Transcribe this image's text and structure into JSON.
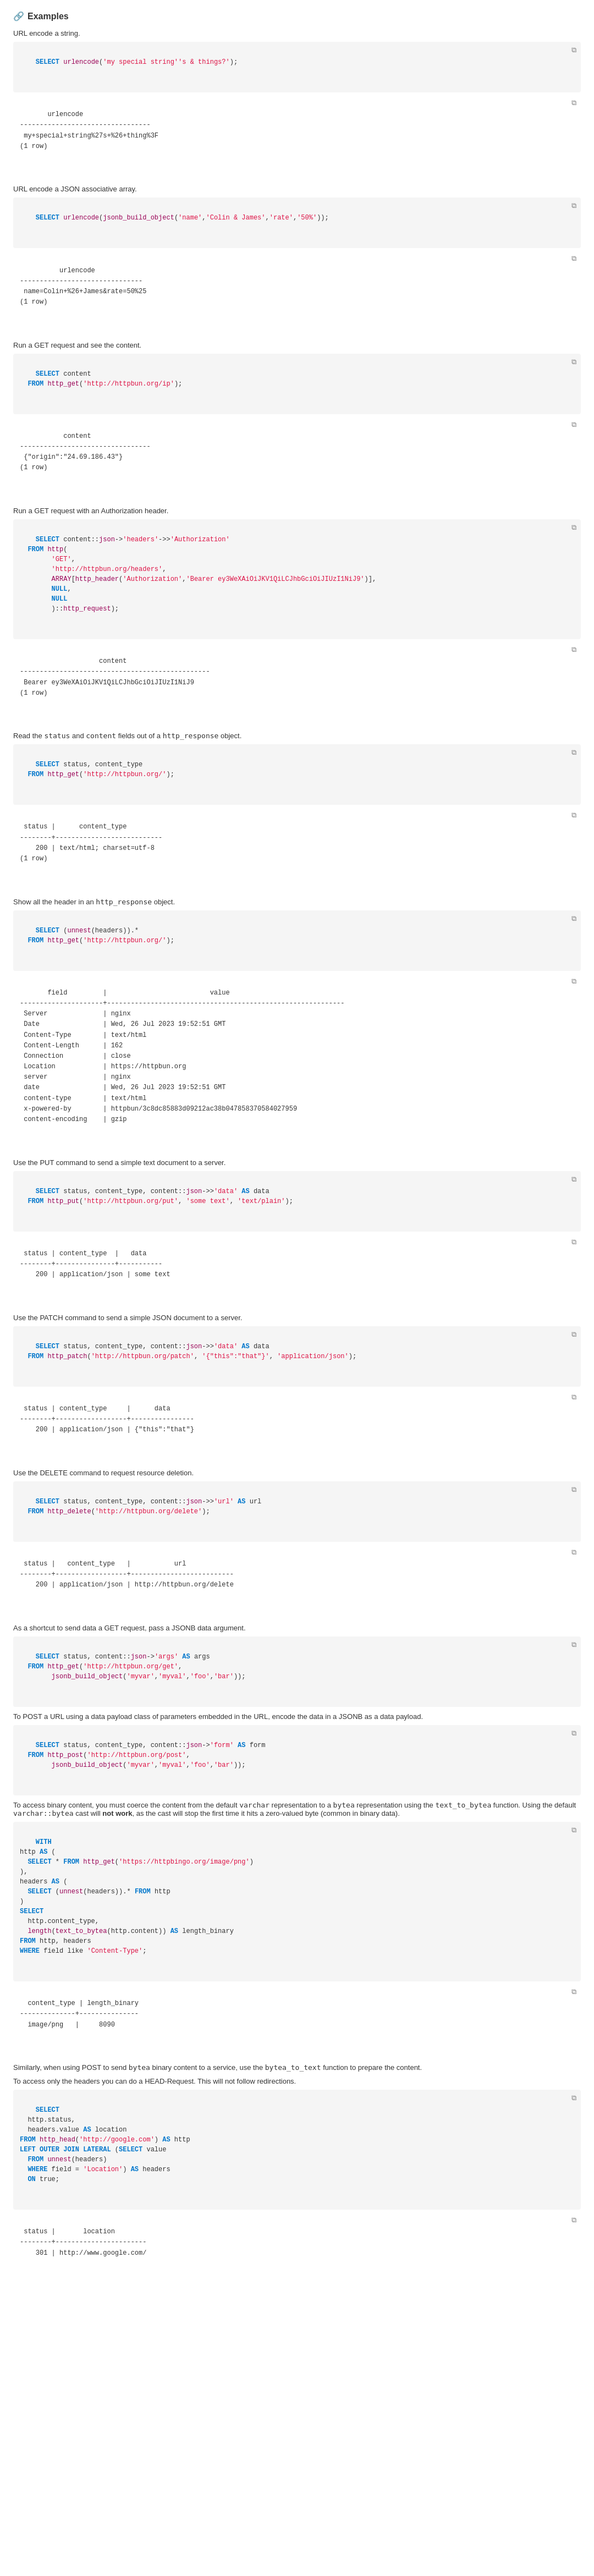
{
  "page": {
    "title": "Examples",
    "sections": [
      {
        "id": "url-encode-string",
        "desc": "URL encode a string.",
        "query": "SELECT urlencode('my special string''s & things?');",
        "result": "       urlencode\n---------------------------------\n my+special+string%27s+%26+thing%3F\n(1 row)"
      },
      {
        "id": "url-encode-json",
        "desc": "URL encode a JSON associative array.",
        "query": "SELECT urlencode(jsonb_build_object('name','Colin & James','rate','50%'));",
        "result": "          urlencode\n-------------------------------\n name=Colin+%26+James&rate=50%25\n(1 row)"
      },
      {
        "id": "get-content",
        "desc": "Run a GET request and see the content.",
        "query": "SELECT content\n  FROM http_get('http://httpbun.org/ip');",
        "result": "           content\n---------------------------------\n {\"origin\":\"24.69.186.43\"}\n(1 row)"
      },
      {
        "id": "get-auth",
        "desc": "Run a GET request with an Authorization header.",
        "query": "SELECT content::json->'headers'->>'Authorization'\n  FROM http(\n        'GET',\n        'http://httpbun.org/headers',\n        ARRAY[http_header('Authorization','Bearer ey3WeXAiOiJKV1QiLCJhbGciOiJIUzI1NiJ9')],\n        NULL,\n        NULL\n        )::http_request);",
        "result": "                    content\n------------------------------------------------\n Bearer ey3WeXAiOiJKV1QiLCJhbGciOiJIUzI1NiJ9\n(1 row)"
      },
      {
        "id": "read-status-content",
        "desc": "Read the status and content fields out of a http_response object.",
        "query": "SELECT status, content_type\n  FROM http_get('http://httpbun.org/');",
        "result": " status |      content_type\n--------+---------------------------\n    200 | text/html; charset=utf-8\n(1 row)"
      },
      {
        "id": "show-all-headers",
        "desc": "Show all the header in an http_response object.",
        "query": "SELECT (unnest(headers)).*\n  FROM http_get('http://httpbun.org/');",
        "result": "       field         |                          value\n---------------------+------------------------------------------------------------\n Server              | nginx\n Date                | Wed, 26 Jul 2023 19:52:51 GMT\n Content-Type        | text/html\n Content-Length      | 162\n Connection          | close\n Location            | https://httpbun.org\n server              | nginx\n date                | Wed, 26 Jul 2023 19:52:51 GMT\n content-type        | text/html\n x-powered-by        | httpbun/3c8dc85883d09212ac38b047858370584027959\n content-encoding    | gzip"
      },
      {
        "id": "put-simple-text",
        "desc": "Use the PUT command to send a simple text document to a server.",
        "query": "SELECT status, content_type, content::json->>'data' AS data\n  FROM http_put('http://httpbun.org/put', 'some text', 'text/plain');",
        "result": " status | content_type | data\n--------+--------------+-----------\n    200 | application/json | some text"
      },
      {
        "id": "patch-simple-json",
        "desc": "Use the PATCH command to send a simple JSON document to a server.",
        "query": "SELECT status, content_type, content::json->>'data' AS data\n  FROM http_patch('http://httpbun.org/patch', '{\"this\":\"that\"}', 'application/json');",
        "result": " status | content_type |      data\n--------+--------------+----------------\n    200 | application/json | {\"this\":\"that\"}"
      },
      {
        "id": "delete-resource",
        "desc": "Use the DELETE command to request resource deletion.",
        "query": "SELECT status, content_type, content::json->>'url' AS url\n  FROM http_delete('http://httpbun.org/delete');",
        "result": " status |   content_type   |           url\n--------+------------------+--------------------------\n    200 | application/json | http://httpbun.org/delete"
      },
      {
        "id": "get-jsonb-args",
        "desc": "As a shortcut to send data a GET request, pass a JSONB data argument.",
        "query": "SELECT status, content::json->'args' AS args\n  FROM http_get('http://httpbun.org/get',\n        jsonb_build_object('myvar','myval','foo','bar'));",
        "result": ""
      },
      {
        "id": "post-url-encoded",
        "desc": "To POST a URL using a data payload class of parameters embedded in the URL, encode the data in a JSONB as a data payload.",
        "query": "SELECT status, content_type, content::json->'form' AS form\n  FROM http_post('http://httpbun.org/post',\n        jsonb_build_object('myvar','myval','foo','bar'));",
        "result": ""
      },
      {
        "id": "binary-content",
        "desc": "To access binary content, you must coerce the content from the default varchar representation to a bytea representation using the text_to_bytea function. Using the default varchar::bytea cast will not work, as the cast will stop the first time it hits a zero-valued byte (common in binary data).",
        "query": "WITH\nhttp AS (\n  SELECT * FROM http_get('https://httpbingo.org/image/png')\n),\nheaders AS (\n  SELECT (unnest(headers)).* FROM http\n)\nSELECT\n  http.content_type,\n  length(text_to_bytea(http.content)) AS length_binary\nFROM http, headers\nWHERE field like 'Content-Type';",
        "result": "  content_type | length_binary\n--------------+---------------\n  image/png   |     8090"
      },
      {
        "id": "post-bytea",
        "desc": "Similarly, when using POST to send bytea binary content to a service, use the bytea_to_text function to prepare the content.",
        "query": "",
        "result": ""
      },
      {
        "id": "head-request",
        "desc": "To access only the headers you can do a HEAD-Request. This will not follow redirections.",
        "query": "SELECT\n  http.status,\n  headers.value AS location\nFROM http_head('http://google.com') AS http\nLEFT OUTER JOIN LATERAL (SELECT value\n  FROM unnest(headers)\n  WHERE field = 'Location') AS headers\n  ON true;",
        "result": " status |       location\n--------+-----------------------\n    301 | http://www.google.com/"
      }
    ]
  }
}
